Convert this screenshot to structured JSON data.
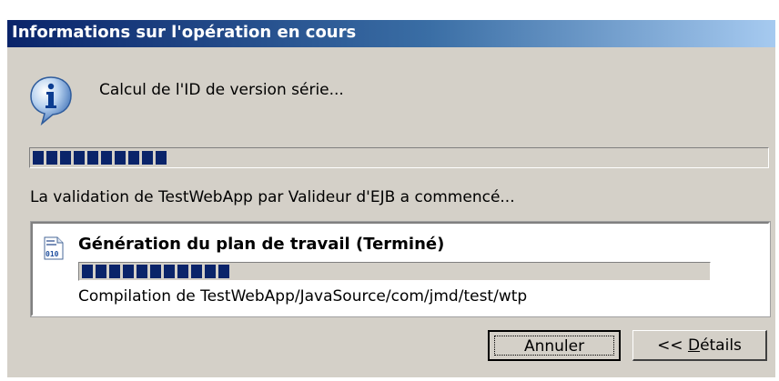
{
  "dialog": {
    "title": "Informations sur l'opération en cours",
    "current_task": "Calcul de l'ID de version série...",
    "main_progress": 0.19,
    "status_text": "La validation de TestWebApp par Valideur d'EJB a commencé..."
  },
  "task": {
    "title": "Génération du plan de travail (Terminé)",
    "progress": 0.25,
    "detail": "Compilation de TestWebApp/JavaSource/com/jmd/test/wtp"
  },
  "buttons": {
    "cancel": "Annuler",
    "details_prefix": "<< ",
    "details_mnemonic": "D",
    "details_rest": "étails"
  },
  "colors": {
    "progress_block": "#0a246a",
    "dialog_bg": "#d4d0c8",
    "title_start": "#0a246a",
    "title_end": "#a6caf0"
  },
  "icons": {
    "dialog": "info-icon",
    "task": "binary-file-icon"
  }
}
